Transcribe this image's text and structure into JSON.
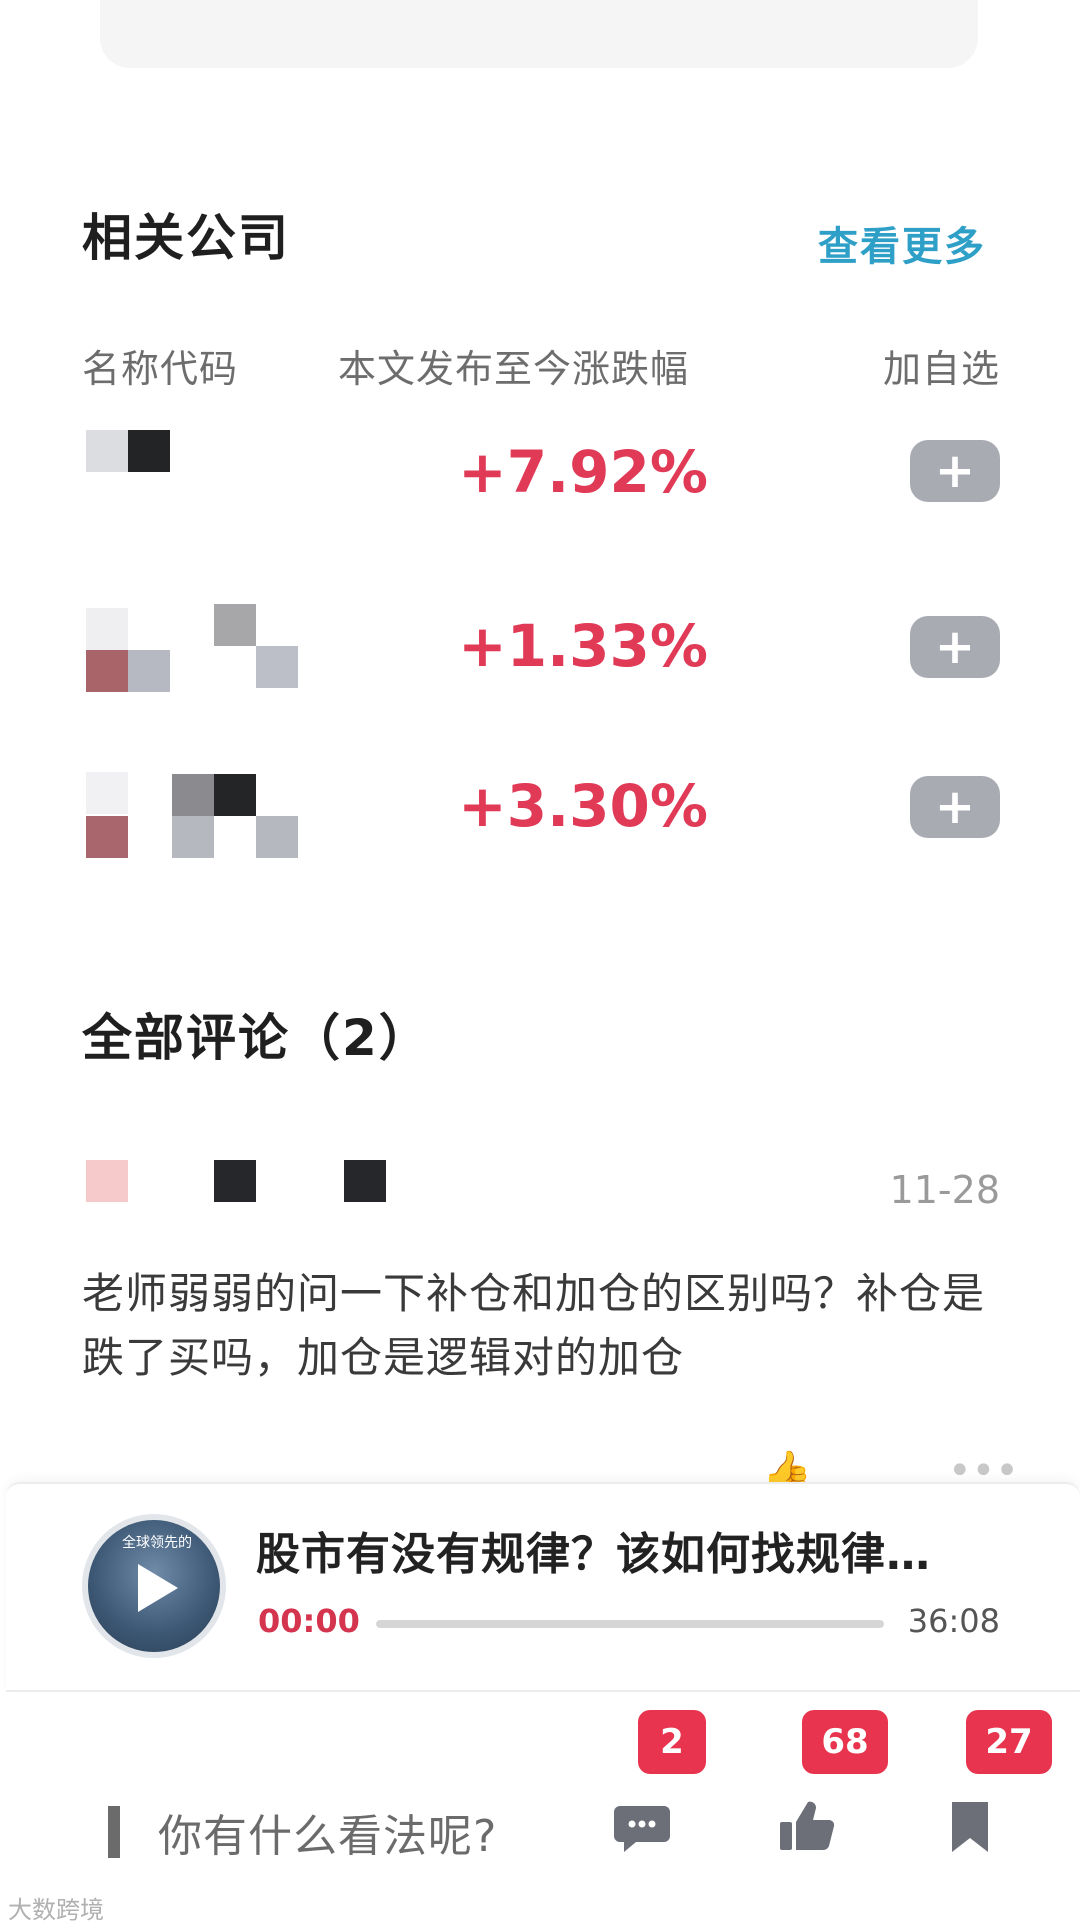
{
  "related": {
    "title": "相关公司",
    "view_more": "查看更多",
    "columns": {
      "name": "名称代码",
      "change": "本文发布至今涨跌幅",
      "watch": "加自选"
    },
    "rows": [
      {
        "change": "+7.92%",
        "add_label": "+"
      },
      {
        "change": "+1.33%",
        "add_label": "+"
      },
      {
        "change": "+3.30%",
        "add_label": "+"
      }
    ]
  },
  "comments": {
    "title": "全部评论（2）",
    "items": [
      {
        "date": "11-28",
        "text": "老师弱弱的问一下补仓和加仓的区别吗？补仓是跌了买吗，加仓是逻辑对的加仓"
      }
    ]
  },
  "player": {
    "title": "股市有没有规律？该如何找规律…",
    "current_time": "00:00",
    "duration": "36:08",
    "progress": 0,
    "thumb_caption": "全球领先的"
  },
  "bottom_bar": {
    "placeholder": "你有什么看法呢?",
    "comment_count": "2",
    "like_count": "68",
    "favorite_count": "27"
  },
  "watermark": "大数跨境",
  "colors": {
    "rise": "#e03a57",
    "link": "#2e9fc7",
    "badge": "#e8344f",
    "add_button": "#a9abb3"
  },
  "icons": [
    "play-icon",
    "comment-icon",
    "thumbs-up-icon",
    "bookmark-icon",
    "plus-icon"
  ]
}
